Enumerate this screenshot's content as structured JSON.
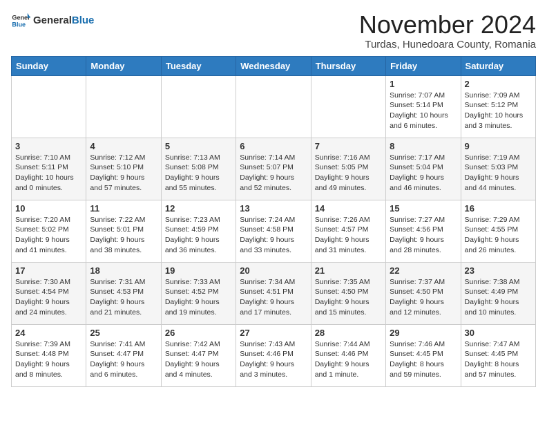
{
  "header": {
    "logo_general": "General",
    "logo_blue": "Blue",
    "month_title": "November 2024",
    "subtitle": "Turdas, Hunedoara County, Romania"
  },
  "weekdays": [
    "Sunday",
    "Monday",
    "Tuesday",
    "Wednesday",
    "Thursday",
    "Friday",
    "Saturday"
  ],
  "weeks": [
    [
      {
        "day": "",
        "info": ""
      },
      {
        "day": "",
        "info": ""
      },
      {
        "day": "",
        "info": ""
      },
      {
        "day": "",
        "info": ""
      },
      {
        "day": "",
        "info": ""
      },
      {
        "day": "1",
        "info": "Sunrise: 7:07 AM\nSunset: 5:14 PM\nDaylight: 10 hours and 6 minutes."
      },
      {
        "day": "2",
        "info": "Sunrise: 7:09 AM\nSunset: 5:12 PM\nDaylight: 10 hours and 3 minutes."
      }
    ],
    [
      {
        "day": "3",
        "info": "Sunrise: 7:10 AM\nSunset: 5:11 PM\nDaylight: 10 hours and 0 minutes."
      },
      {
        "day": "4",
        "info": "Sunrise: 7:12 AM\nSunset: 5:10 PM\nDaylight: 9 hours and 57 minutes."
      },
      {
        "day": "5",
        "info": "Sunrise: 7:13 AM\nSunset: 5:08 PM\nDaylight: 9 hours and 55 minutes."
      },
      {
        "day": "6",
        "info": "Sunrise: 7:14 AM\nSunset: 5:07 PM\nDaylight: 9 hours and 52 minutes."
      },
      {
        "day": "7",
        "info": "Sunrise: 7:16 AM\nSunset: 5:05 PM\nDaylight: 9 hours and 49 minutes."
      },
      {
        "day": "8",
        "info": "Sunrise: 7:17 AM\nSunset: 5:04 PM\nDaylight: 9 hours and 46 minutes."
      },
      {
        "day": "9",
        "info": "Sunrise: 7:19 AM\nSunset: 5:03 PM\nDaylight: 9 hours and 44 minutes."
      }
    ],
    [
      {
        "day": "10",
        "info": "Sunrise: 7:20 AM\nSunset: 5:02 PM\nDaylight: 9 hours and 41 minutes."
      },
      {
        "day": "11",
        "info": "Sunrise: 7:22 AM\nSunset: 5:01 PM\nDaylight: 9 hours and 38 minutes."
      },
      {
        "day": "12",
        "info": "Sunrise: 7:23 AM\nSunset: 4:59 PM\nDaylight: 9 hours and 36 minutes."
      },
      {
        "day": "13",
        "info": "Sunrise: 7:24 AM\nSunset: 4:58 PM\nDaylight: 9 hours and 33 minutes."
      },
      {
        "day": "14",
        "info": "Sunrise: 7:26 AM\nSunset: 4:57 PM\nDaylight: 9 hours and 31 minutes."
      },
      {
        "day": "15",
        "info": "Sunrise: 7:27 AM\nSunset: 4:56 PM\nDaylight: 9 hours and 28 minutes."
      },
      {
        "day": "16",
        "info": "Sunrise: 7:29 AM\nSunset: 4:55 PM\nDaylight: 9 hours and 26 minutes."
      }
    ],
    [
      {
        "day": "17",
        "info": "Sunrise: 7:30 AM\nSunset: 4:54 PM\nDaylight: 9 hours and 24 minutes."
      },
      {
        "day": "18",
        "info": "Sunrise: 7:31 AM\nSunset: 4:53 PM\nDaylight: 9 hours and 21 minutes."
      },
      {
        "day": "19",
        "info": "Sunrise: 7:33 AM\nSunset: 4:52 PM\nDaylight: 9 hours and 19 minutes."
      },
      {
        "day": "20",
        "info": "Sunrise: 7:34 AM\nSunset: 4:51 PM\nDaylight: 9 hours and 17 minutes."
      },
      {
        "day": "21",
        "info": "Sunrise: 7:35 AM\nSunset: 4:50 PM\nDaylight: 9 hours and 15 minutes."
      },
      {
        "day": "22",
        "info": "Sunrise: 7:37 AM\nSunset: 4:50 PM\nDaylight: 9 hours and 12 minutes."
      },
      {
        "day": "23",
        "info": "Sunrise: 7:38 AM\nSunset: 4:49 PM\nDaylight: 9 hours and 10 minutes."
      }
    ],
    [
      {
        "day": "24",
        "info": "Sunrise: 7:39 AM\nSunset: 4:48 PM\nDaylight: 9 hours and 8 minutes."
      },
      {
        "day": "25",
        "info": "Sunrise: 7:41 AM\nSunset: 4:47 PM\nDaylight: 9 hours and 6 minutes."
      },
      {
        "day": "26",
        "info": "Sunrise: 7:42 AM\nSunset: 4:47 PM\nDaylight: 9 hours and 4 minutes."
      },
      {
        "day": "27",
        "info": "Sunrise: 7:43 AM\nSunset: 4:46 PM\nDaylight: 9 hours and 3 minutes."
      },
      {
        "day": "28",
        "info": "Sunrise: 7:44 AM\nSunset: 4:46 PM\nDaylight: 9 hours and 1 minute."
      },
      {
        "day": "29",
        "info": "Sunrise: 7:46 AM\nSunset: 4:45 PM\nDaylight: 8 hours and 59 minutes."
      },
      {
        "day": "30",
        "info": "Sunrise: 7:47 AM\nSunset: 4:45 PM\nDaylight: 8 hours and 57 minutes."
      }
    ]
  ]
}
